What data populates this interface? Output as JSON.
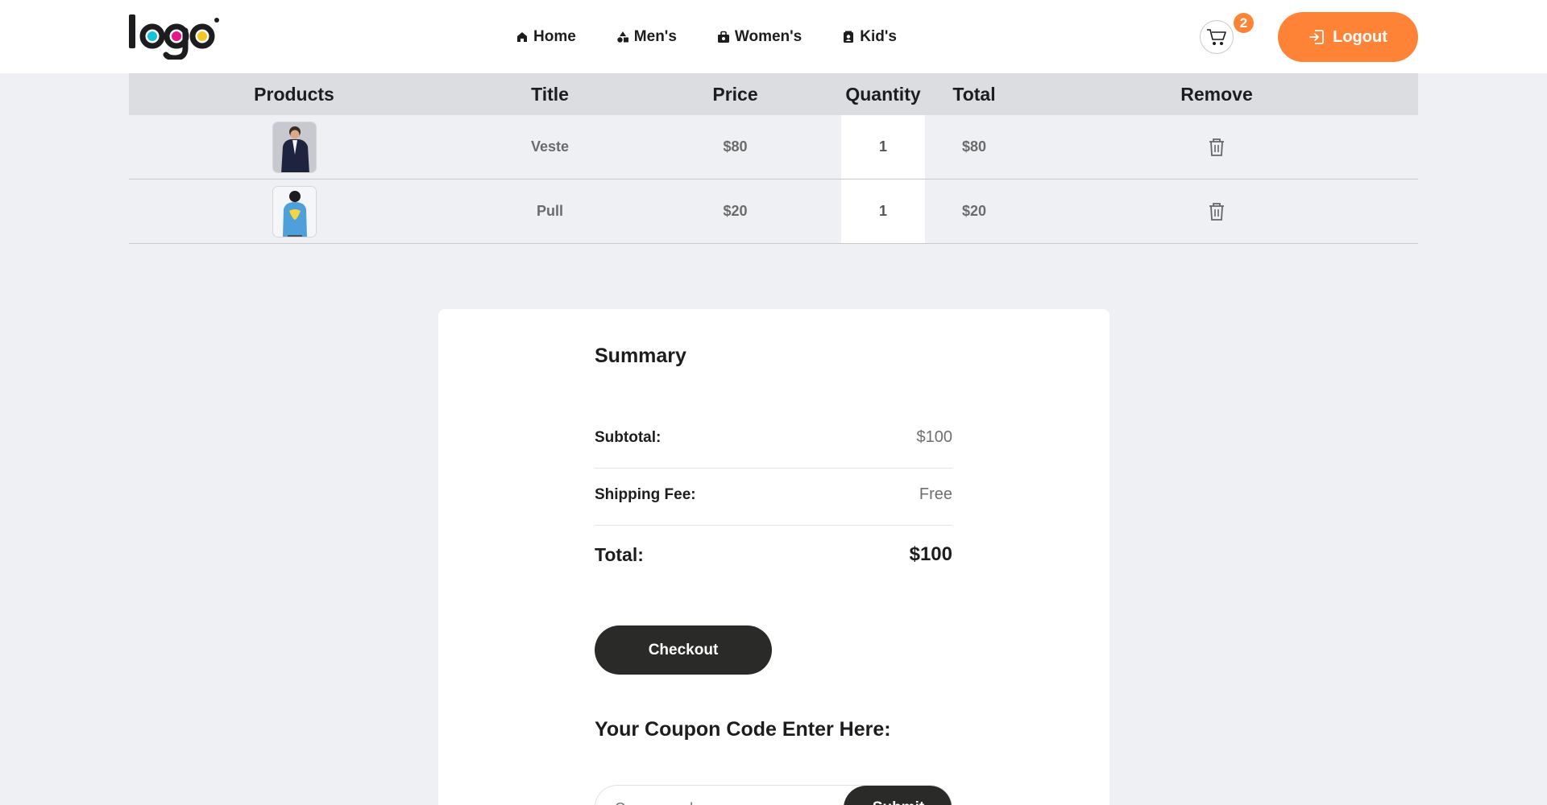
{
  "header": {
    "logo_text": "logo",
    "nav": [
      {
        "label": "Home",
        "icon": "home-icon"
      },
      {
        "label": "Men's",
        "icon": "shapes-icon"
      },
      {
        "label": "Women's",
        "icon": "bag-icon"
      },
      {
        "label": "Kid's",
        "icon": "contact-icon"
      }
    ],
    "cart_count": "2",
    "logout_label": "Logout"
  },
  "table": {
    "headers": [
      "Products",
      "Title",
      "Price",
      "Quantity",
      "Total",
      "Remove"
    ],
    "rows": [
      {
        "title": "Veste",
        "price": "$80",
        "quantity": "1",
        "total": "$80"
      },
      {
        "title": "Pull",
        "price": "$20",
        "quantity": "1",
        "total": "$20"
      }
    ]
  },
  "summary": {
    "title": "Summary",
    "subtotal_label": "Subtotal:",
    "subtotal_value": "$100",
    "shipping_label": "Shipping Fee:",
    "shipping_value": "Free",
    "total_label": "Total:",
    "total_value": "$100",
    "checkout_label": "Checkout",
    "coupon_title": "Your Coupon Code Enter Here:",
    "coupon_placeholder": "Coupon code",
    "submit_label": "Submit"
  },
  "colors": {
    "accent": "#ff8336",
    "dark_button": "#2a2b28",
    "background": "#eff0f4",
    "logo_cyan": "#11c5d9",
    "logo_magenta": "#e5158a",
    "logo_yellow": "#f3c623"
  }
}
